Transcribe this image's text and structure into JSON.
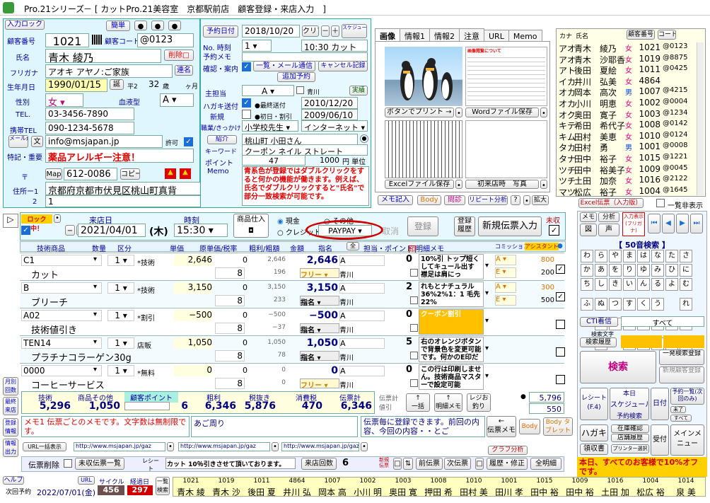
{
  "window": {
    "app": "Pro.21シリーズ",
    "title": "－ [ カットPro.21美容室　京都駅前店　顧客登録・来店入力　]"
  },
  "customer": {
    "black_label": "入力ロック",
    "simple_label": "簡単",
    "no_label": "顧客番号",
    "no": "1021",
    "code_label": "顧客コード",
    "code": "@0123",
    "name_label": "氏名",
    "name": "青木 綾乃",
    "delete_label": "削除",
    "kana_label": "フリガナ",
    "kana": "アオキ アヤノ:ご家族",
    "linked_label": "連名",
    "birth_label": "生年月日",
    "birth": "1990/01/15",
    "birth_btn": "誕",
    "era": "平2",
    "age": "32",
    "age_unit": "歳",
    "month_unit": "ヶ月",
    "gender_label": "性別",
    "gender": "女",
    "blood_label": "血液型",
    "blood": "A",
    "tel_label": "TEL.",
    "tel": "03-3456-7890",
    "mobile_label": "携帯TEL",
    "mobile": "090-1234-5678",
    "mail_label": "メール送信",
    "mail_btn": "文",
    "mail": "info@msjapan.jp",
    "permit_label": "許可",
    "note_label": "特記・重要",
    "note": "薬品アレルギー注意！",
    "zip_label": "〒",
    "map_btn": "Map",
    "zip": "612-0086",
    "copy_btn": "コピー",
    "addr_label": "住所ー1",
    "addr1": "京都府京都市伏見区桃山町真背",
    "addr2_label": "2",
    "addr2": "1",
    "addr_btn": "文"
  },
  "visit": {
    "date_label": "予約日付",
    "date": "2018/10/20",
    "clear": "クリア",
    "minus": "－",
    "plus": "＋",
    "sched_btn": "スケジュール登録",
    "no_time_label": "No. 時刻",
    "no_val": "1",
    "time_val": "10:30 カット",
    "memo_label": "予約メモ",
    "confirm_label": "確認・案内",
    "list_btn": "一覧・メール通信",
    "cancel_btn": "キャンセル記録",
    "add_btn": "追加予約",
    "staff_label": "主担当",
    "staff": "A",
    "staff_name": "青川",
    "reserve_btn": "実績",
    "postcard_label": "ハガキ送付",
    "last_visit_label": "最終送付",
    "last_visit": "2010/12/20",
    "new_label": "新規",
    "first_label": "初日・割引",
    "first": "2009/06/10",
    "job_label": "職業/きっかけ",
    "job": "小学校先生",
    "trigger": "インターネット",
    "intro_label": "紹介",
    "intro": "桃山町 小田さん",
    "keyword_label": "キーワード",
    "keyword": "クーポン ネイル ストレート",
    "point_label": "ポイント",
    "point": "47",
    "point_unit_val": "1000",
    "point_unit": "円 単位",
    "memo2_label": "Memo",
    "memo2": "青系色が登録ではダブルクリックをすると何かの機能が働きます。例えば、氏名でダブルクリックすると\"氏名\"で部分一致検索が可能です。"
  },
  "media": {
    "tabs": [
      "画像",
      "情報1",
      "情報2",
      "注意",
      "URL",
      "Memo"
    ],
    "doc_title": "画像閲覧について",
    "print_btn": "ボタンでプリント →",
    "word_btn": "Wordファイル保存",
    "excel_btn": "Excelファイル保存",
    "first_btn": "初来店時　写真",
    "memo_btn": "メモ記入",
    "body_btn": "Body",
    "tel_btn": "問診",
    "repeat_btn": "リピート分析",
    "help": "?",
    "zoom": "拡大"
  },
  "custlist": {
    "head_kana": "カナ",
    "head_name": "氏名",
    "head_no": "顧客番号",
    "head_code": "コード",
    "rows": [
      {
        "k": "アオ",
        "n": "青木　綾乃",
        "s": "女",
        "no": "1021",
        "c": "@0123"
      },
      {
        "k": "アオ",
        "n": "青木　沙耶香",
        "s": "女",
        "no": "1019",
        "c": "@8875"
      },
      {
        "k": "アト",
        "n": "後田　夏絵",
        "s": "女",
        "no": "1011",
        "c": "@0425"
      },
      {
        "k": "イカ",
        "n": "井川　弘美",
        "s": "女",
        "no": "4864",
        "c": ""
      },
      {
        "k": "オカ",
        "n": "岡本　高次",
        "s": "男",
        "no": "1007",
        "c": "@4215"
      },
      {
        "k": "オカ",
        "n": "小川　明恵",
        "s": "女",
        "no": "1002",
        "c": "@0004"
      },
      {
        "k": "オク",
        "n": "奥田　寛子",
        "s": "女",
        "no": "1003",
        "c": "@1234"
      },
      {
        "k": "キテ",
        "n": "希田　希代子",
        "s": "女",
        "no": "1008",
        "c": "@0142"
      },
      {
        "k": "キム",
        "n": "田村　美恵",
        "s": "女",
        "no": "1010",
        "c": "@0124"
      },
      {
        "k": "タカ",
        "n": "田村　勇",
        "s": "男",
        "no": "1001",
        "c": "@0008"
      },
      {
        "k": "タナ",
        "n": "田中　裕子",
        "s": "女",
        "no": "1015",
        "c": "@1221"
      },
      {
        "k": "ツチ",
        "n": "田中　裕美子",
        "s": "女",
        "no": "1009",
        "c": "@0045"
      },
      {
        "k": "ツチ",
        "n": "土田　加奈",
        "s": "女",
        "no": "1016",
        "c": "@2122"
      },
      {
        "k": "マツ",
        "n": "松広　裕子",
        "s": "女",
        "no": "1004",
        "c": "@1645"
      }
    ],
    "excel_btn": "Excel伝票（入力版）",
    "all_label": "一覧非表示"
  },
  "slip": {
    "lock": "ロック中！",
    "date_label": "来店日",
    "date": "2021/04/01",
    "dow": "(木)",
    "time_label": "時刻",
    "time": "15:30",
    "shop_label": "商品仕入",
    "cash": "現金",
    "other": "その他",
    "credit": "クレジット",
    "pay_method": "PAYPAY",
    "cancel": "取消",
    "register": "登録",
    "register2": "登録履歴",
    "new_btn": "新規伝票入力",
    "unpaid": "未収",
    "headers": [
      "技術商品",
      "数量",
      "区分",
      "単価",
      "原単価/税率",
      "粗利/粗額",
      "金額",
      "指名",
      "担当・ポイント",
      "明細メモ",
      "コミッション",
      "アシスタント"
    ],
    "rows": [
      {
        "code": "C1",
        "name": "カット",
        "qty": "1",
        "kind": "*技術",
        "price": "2,646",
        "tax": "8",
        "cost": "0",
        "gross": "2,646",
        "gross2": "196",
        "amount": "2,646",
        "nom": "フリー",
        "staff": "A",
        "staff_name": "青川",
        "pt": "0",
        "memo": "10%引 トップ短くしてキュール出す 襟足は肩にっ",
        "comA": "A",
        "comE": "E",
        "c1": "800",
        "c2": "200"
      },
      {
        "code": "B",
        "name": "ブリーチ",
        "qty": "1",
        "kind": "*技術",
        "price": "3,150",
        "tax": "8",
        "cost": "0",
        "gross": "3,150",
        "gross2": "233",
        "amount": "3,150",
        "nom": "指名",
        "staff": "A",
        "staff_name": "青川",
        "pt": "2",
        "memo": "れもとナチュラル 36%2%1：1 毛先22%",
        "comA": "A",
        "comE": "E",
        "c1": "300",
        "c2": "500"
      },
      {
        "code": "A02",
        "name": "技術値引き",
        "qty": "1",
        "kind": "*割引",
        "price": "−500",
        "tax": "8",
        "cost": "0",
        "gross": "−500",
        "gross2": "−37",
        "amount": "−500",
        "nom": "指名",
        "staff": "A",
        "staff_name": "青川",
        "pt": "0",
        "memo": "クーポン割引",
        "comA": "",
        "comE": "",
        "c1": "",
        "c2": ""
      },
      {
        "code": "TEN14",
        "name": "プラチナコラーゲン30g",
        "qty": "1",
        "kind": "店販",
        "price": "1,050",
        "tax": "8",
        "cost": "0",
        "gross": "1,050",
        "gross2": "78",
        "amount": "1,050",
        "nom": "指名",
        "staff": "A",
        "staff_name": "青川",
        "pt": "5",
        "memo": "右のオレンジボタンで背景色を変更可能です。何かのE印だけにご使用に",
        "comA": "",
        "comE": "",
        "c1": "",
        "c2": ""
      },
      {
        "code": "0000",
        "name": "コーヒーサービス",
        "qty": "1",
        "kind": "*無料",
        "price": "0",
        "tax": "8",
        "cost": "0",
        "gross": "0",
        "gross2": "0",
        "amount": "0",
        "nom": "フリー",
        "staff": "A",
        "staff_name": "青川",
        "pt": "0",
        "memo": "この行は印刷しません。技術商品マスターで設定可能",
        "comA": "",
        "comE": "",
        "c1": "",
        "c2": ""
      }
    ],
    "totals": {
      "tech_label": "技術",
      "tech": "5,296",
      "goods_label": "商品その他",
      "goods": "1,050",
      "pt_label": "顧客ポイント",
      "pt": "6",
      "gross_label": "粗利",
      "gross": "6,346",
      "net_label": "税抜き",
      "net": "5,876",
      "tax_label": "消費税",
      "tax": "470",
      "total_label": "伝票計",
      "total": "6,346",
      "slip_label": "伝票計値引",
      "cnt_label": "一括",
      "cnt": "明細メモ",
      "reg_label": "レジお釣り",
      "cash1": "5,796",
      "cash2": "550"
    }
  },
  "memos": {
    "memo1": "メモ1 伝票ごとのメモです。文字数は無制限です。",
    "memo2": "あご周り",
    "memo3": "伝票毎に登録できます。前回の内容、今回の内容・・とご",
    "memo_btn": "伝票メモ",
    "body": "Body",
    "body2": "Body タブレット"
  },
  "urls": {
    "label": "URL一括表示",
    "u1": "http://www.msjapan.jp/gaz",
    "u2": "http://www.msjapan.jp/gaz",
    "u3": "http://www.msjapan.jp/gaz",
    "graph": "グラフ分析"
  },
  "bottom": {
    "del": "伝票削除",
    "unpaid_list": "未収伝票一覧",
    "receipt": "レシート",
    "note": "カット 10％引きさせて頂いております。",
    "count_label": "来店回数",
    "count": "6",
    "new_btn": "新規伝票",
    "prev": "前伝票",
    "next": "次伝票",
    "hist": "履歴・修正",
    "all": "全明細"
  },
  "side": {
    "side1": "月別回数",
    "side2": "最終来店",
    "side3": "登録情報",
    "side4": "情報出力",
    "help": "ヘルプ",
    "next_label": "次回予約",
    "next_date": "2022/07/01(金)",
    "cycle_label": "サイクル",
    "cycle": "456",
    "days_label": "経過日",
    "days": "297"
  },
  "right": {
    "memo": "メモ",
    "analysis": "分析",
    "search_input": "入力表示(フリガナ)",
    "photo": "図",
    "voice": "声",
    "kana_title": "【 50音検索 】",
    "kana": [
      "わ",
      "ら",
      "や",
      "ま",
      "は",
      "な",
      "た",
      "さ",
      "か",
      "あ",
      "を",
      "り",
      "ゆ",
      "み",
      "ひ",
      "に",
      "ち",
      "し",
      "き",
      "い",
      "ん",
      "る",
      "よ",
      "む",
      "ふ",
      "ぬ",
      "つ",
      "す",
      "く",
      "う",
      "",
      "れ",
      "",
      "め",
      "へ",
      "ね",
      "て",
      "せ",
      "け",
      "え",
      "",
      "ろ",
      "",
      "も",
      "ほ",
      "の",
      "と",
      "そ",
      "こ",
      "お"
    ],
    "cti": "CTI着信",
    "all": "すべて",
    "search_chars": "検索文字",
    "history": "検索履歴",
    "search": "検索",
    "list_reg": "一発検索登録",
    "new_reg": "新規顧客登録",
    "receipt": "レシート(F.4)",
    "today": "本日",
    "schedule": "スケジュール",
    "reserved": "予約検索",
    "date": "日付",
    "reserve_list": "予約一覧(次回のみ)",
    "all2": "すべて",
    "unpaid": "未了",
    "postcard": "ハガキ",
    "stock": "在庫確認",
    "shop": "店舗履歴",
    "accounts": "受付",
    "menu": "メインメニュー",
    "receipt2": "領収書",
    "printer": "プリンター選択",
    "announce": "本日、すべてのお客様で10%オフです。"
  },
  "ticker": {
    "label": "一覧検索",
    "nums": [
      "1021",
      "1019",
      "1011",
      "4864",
      "1007",
      "1002",
      "1003",
      "1008",
      "1010",
      "1001",
      "1015",
      "1009",
      "1016",
      "1004",
      "1014"
    ],
    "names": [
      "青木 綾",
      "青木 沙",
      "後田 夏",
      "井川 弘",
      "岡本 高",
      "小川 明",
      "奥田 寛",
      "押田 希",
      "田村 美",
      "田川 孝",
      "田中 裕",
      "田中 裕",
      "土田 加",
      "松広 裕",
      "泉 美"
    ]
  }
}
